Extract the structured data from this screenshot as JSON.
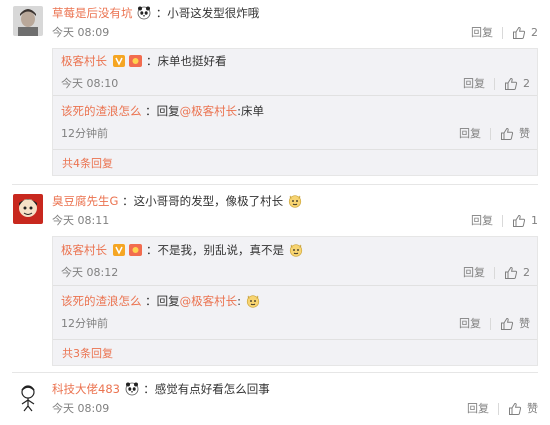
{
  "comments": [
    {
      "user": "草莓是后没有坑",
      "text": "：小哥这发型很炸哦",
      "time": "今天 08:09",
      "reply_label": "回复",
      "likes": "2",
      "replies": [
        {
          "user": "极客村长",
          "text": "：床单也挺好看",
          "time": "今天 08:10",
          "reply_label": "回复",
          "likes": "2"
        },
        {
          "user": "该死的渣浪怎么",
          "text": "：回复",
          "mention": "@极客村长",
          "text_after": ":床单",
          "time": "12分钟前",
          "reply_label": "回复",
          "likes": "赞"
        }
      ],
      "more": "共4条回复"
    },
    {
      "user": "臭豆腐先生G",
      "text": "：这小哥哥的发型，像极了村长",
      "time": "今天 08:11",
      "reply_label": "回复",
      "likes": "1",
      "replies": [
        {
          "user": "极客村长",
          "text": "：不是我，别乱说，真不是",
          "time": "今天 08:12",
          "reply_label": "回复",
          "likes": "2"
        },
        {
          "user": "该死的渣浪怎么",
          "text": "：回复",
          "mention": "@极客村长",
          "text_after": ":",
          "time": "12分钟前",
          "reply_label": "回复",
          "likes": "赞"
        }
      ],
      "more": "共3条回复"
    },
    {
      "user": "科技大佬483",
      "text": "：感觉有点好看怎么回事",
      "time": "今天 08:09",
      "reply_label": "回复",
      "likes": "赞"
    }
  ],
  "colors": {
    "username": "#eb7350",
    "meta": "#808080",
    "reply_bg": "#f2f2f5"
  },
  "icons": [
    "panda-emoji-icon",
    "vip-v-icon",
    "level-badge-icon",
    "dog-face-emoji-icon",
    "thumb-up-icon"
  ]
}
